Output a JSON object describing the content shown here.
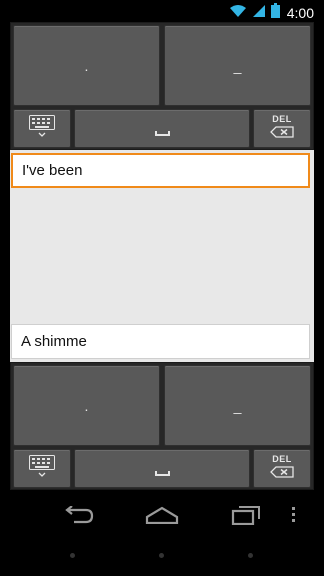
{
  "status_bar": {
    "time": "4:00",
    "icons": [
      "wifi-icon",
      "signal-icon",
      "battery-icon"
    ]
  },
  "keyboard_top": {
    "key_left_label": ".",
    "key_right_label": "_",
    "del_label": "DEL",
    "icons": [
      "keyboard-icon",
      "space-icon",
      "backspace-icon"
    ]
  },
  "text_fields": {
    "top_value": "I've been",
    "bottom_value": "A shimme"
  },
  "keyboard_bottom": {
    "key_left_label": ".",
    "key_right_label": "_",
    "del_label": "DEL",
    "icons": [
      "keyboard-icon",
      "space-icon",
      "backspace-icon"
    ]
  },
  "nav_bar": {
    "icons": [
      "back-icon",
      "home-icon",
      "recents-icon",
      "overflow-menu-icon"
    ]
  },
  "colors": {
    "focus_accent": "#f08a1a",
    "key_face": "#595959",
    "panel_bg": "#272727",
    "text_area_bg": "#e8e8e8"
  }
}
